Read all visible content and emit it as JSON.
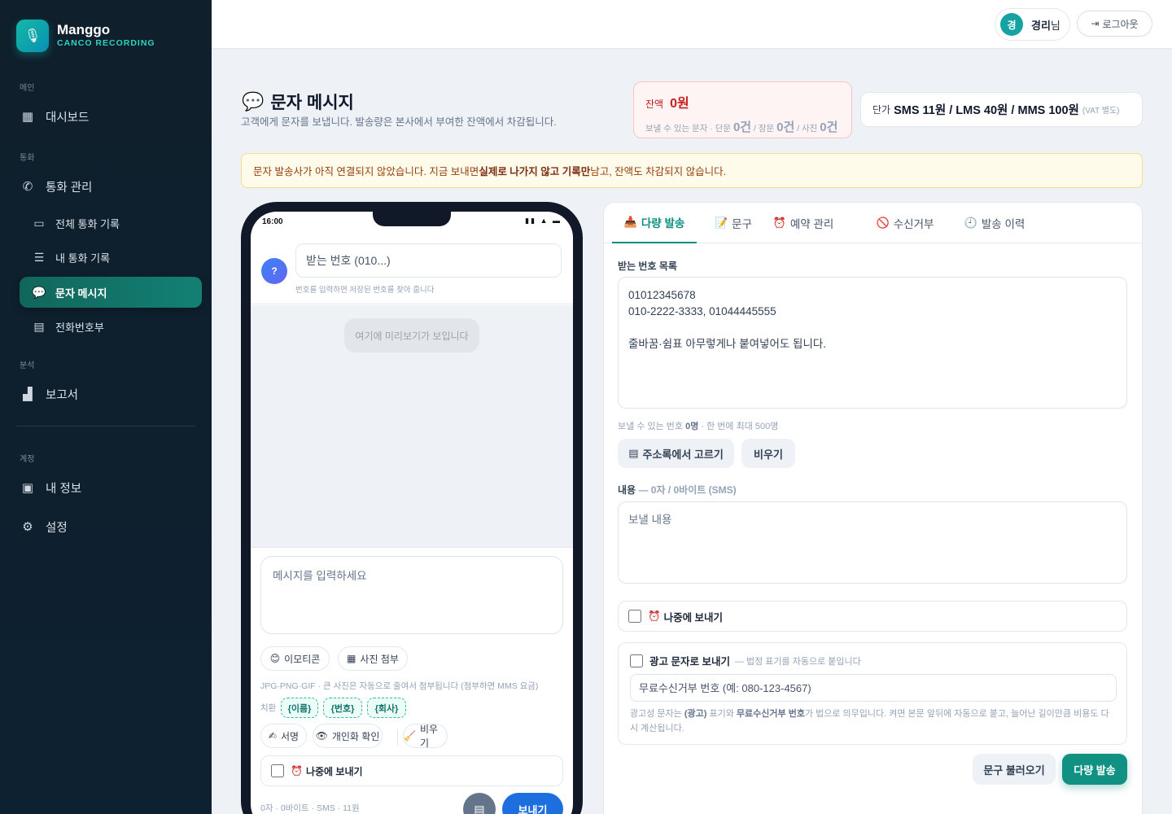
{
  "brand": {
    "name": "Manggo",
    "sub": "CANCO RECORDING",
    "icon": "mic-icon"
  },
  "sidebar": {
    "sections": {
      "main": "메인",
      "call": "통화",
      "analysis": "분석",
      "account": "계정"
    },
    "items": [
      {
        "label": "대시보드",
        "icon": "dashboard-icon"
      },
      {
        "label": "통화 관리",
        "icon": "phone-icon"
      },
      {
        "label": "전체 통화 기록",
        "icon": "folder-icon"
      },
      {
        "label": "내 통화 기록",
        "icon": "user-list-icon"
      },
      {
        "label": "문자 메시지",
        "icon": "chat-icon",
        "active": true
      },
      {
        "label": "전화번호부",
        "icon": "contacts-book-icon"
      },
      {
        "label": "보고서",
        "icon": "bar-chart-icon"
      },
      {
        "label": "내 정보",
        "icon": "profile-icon"
      },
      {
        "label": "설정",
        "icon": "gear-icon"
      }
    ]
  },
  "topbar": {
    "avatar": "경",
    "user_name": "경리",
    "user_suffix": "님",
    "logout": "로그아웃"
  },
  "header": {
    "title": "문자 메시지",
    "desc": "고객에게 문자를 보냅니다. 발송량은 본사에서 부여한 잔액에서 차감됩니다."
  },
  "balance": {
    "label": "잔액",
    "value": "0원",
    "sendable_prefix": "보낼 수 있는 문자 · 단문",
    "short_count": "0건",
    "long_label": "/ 장문",
    "long_count": "0건",
    "photo_label": "/ 사진",
    "photo_count": "0건"
  },
  "pricing": {
    "label": "단가",
    "value": "SMS 11원 / LMS 40원 / MMS 100원",
    "vat": "(VAT 별도)"
  },
  "warning": {
    "pre": "문자 발송사가 아직 연결되지 않았습니다. 지금 보내면 ",
    "bold": "실제로 나가지 않고 기록만",
    "post": " 남고, 잔액도 차감되지 않습니다."
  },
  "phone": {
    "time": "16:00",
    "status_icons": "▮▮ ▲ ▬",
    "avatar": "?",
    "recipient_placeholder": "받는 번호 (010...)",
    "recipient_hint": "번호를 입력하면 저장된 번호를 찾아 줍니다",
    "preview_placeholder": "여기에 미리보기가 보입니다",
    "message_placeholder": "메시지를 입력하세요",
    "emoji_btn": "이모티콘",
    "photo_btn": "사진 첨부",
    "photo_note": "JPG·PNG·GIF · 큰 사진은 자동으로 줄여서 첨부됩니다 (첨부하면 MMS 요금)",
    "substitute_label": "치환",
    "tokens": [
      "{이름}",
      "{번호}",
      "{회사}"
    ],
    "signature_btn": "서명",
    "personalize_btn": "개인화 확인",
    "clear_btn": "비우기",
    "later_label": "나중에 보내기",
    "footer": "0자 · 0바이트 · SMS · 11원",
    "send_btn": "보내기"
  },
  "panel": {
    "tabs": [
      {
        "label": "다량 발송",
        "icon": "inbox-send-icon",
        "active": true
      },
      {
        "label": "문구",
        "icon": "memo-icon"
      },
      {
        "label": "예약 관리",
        "icon": "alarm-clock-icon"
      },
      {
        "label": "수신거부",
        "icon": "prohibited-icon"
      },
      {
        "label": "발송 이력",
        "icon": "clock-icon"
      }
    ],
    "numbers_label": "받는 번호 목록",
    "numbers_text": "01012345678\n010-2222-3333, 01044445555\n\n줄바꿈·쉼표 아무렇게나 붙여넣어도 됩니다.",
    "numbers_note_pre": "보낼 수 있는 번호",
    "numbers_note_bold": "0명",
    "numbers_note_post": "· 한 번에 최대 500명",
    "pick_contacts": "주소록에서 고르기",
    "clear": "비우기",
    "content_label": "내용",
    "content_meta": "— 0자 / 0바이트 (SMS)",
    "content_placeholder": "보낼 내용",
    "later_label": "나중에 보내기",
    "ad_label": "광고 문자로 보내기",
    "ad_hint": "— 법정 표기를 자동으로 붙입니다",
    "ad_placeholder": "무료수신거부 번호 (예: 080-123-4567)",
    "ad_note_1": "광고성 문자는",
    "ad_note_b1": "(광고)",
    "ad_note_2": "표기와",
    "ad_note_b2": "무료수신거부 번호",
    "ad_note_3": "가 법으로 의무입니다. 켜면 본문 앞뒤에 자동으로 붙고, 늘어난 길이만큼 비용도 다시 계산됩니다.",
    "load_phrase": "문구 불러오기",
    "bulk_send": "다량 발송"
  }
}
